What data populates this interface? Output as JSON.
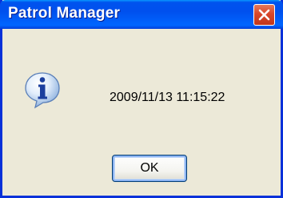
{
  "window": {
    "title": "Patrol Manager"
  },
  "titlebar": {
    "close_icon": "close-icon"
  },
  "dialog": {
    "icon": "info-icon",
    "message": "2009/11/13 11:15:22"
  },
  "buttons": {
    "ok_label": "OK"
  },
  "colors": {
    "titlebar": "#0054E3",
    "window_bg": "#ECE9D8",
    "close_button": "#D9472A"
  }
}
